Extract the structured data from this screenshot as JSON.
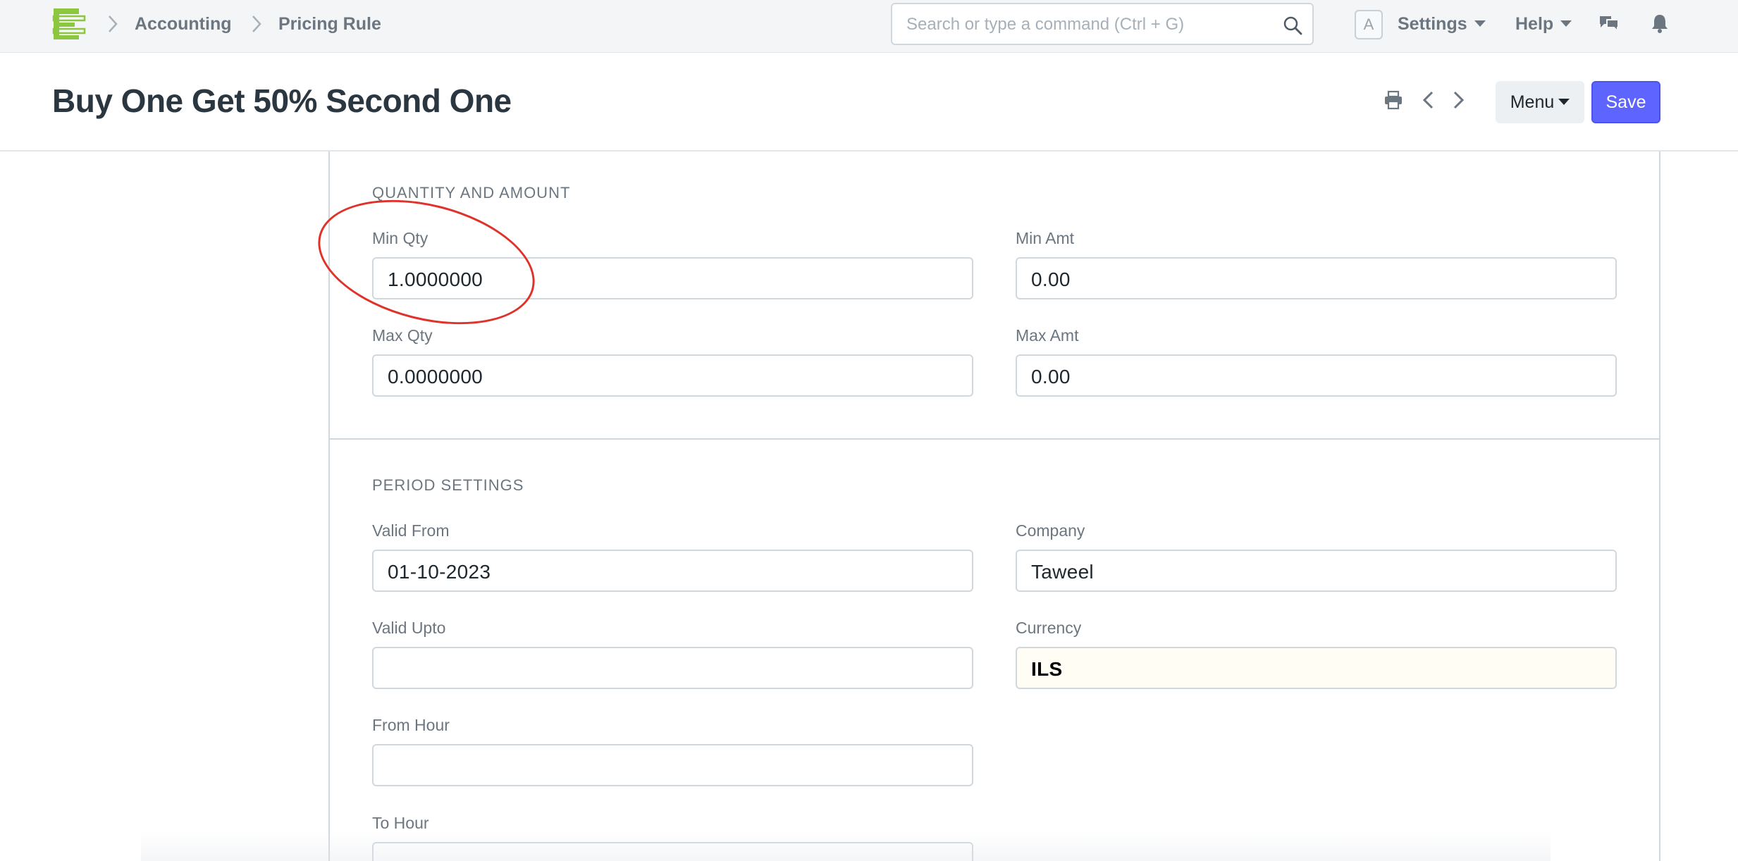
{
  "navbar": {
    "breadcrumbs": [
      {
        "label": "Accounting"
      },
      {
        "label": "Pricing Rule"
      }
    ],
    "search": {
      "placeholder": "Search or type a command (Ctrl + G)"
    },
    "avatar_letter": "A",
    "settings_label": "Settings",
    "help_label": "Help",
    "logo_color": "#8dc63f"
  },
  "page": {
    "title": "Buy One Get 50% Second One",
    "menu_label": "Menu",
    "save_label": "Save",
    "accent_color": "#5e64ff"
  },
  "sections": {
    "quantity": {
      "heading": "QUANTITY AND AMOUNT",
      "min_qty": {
        "label": "Min Qty",
        "value": "1.0000000"
      },
      "min_amt": {
        "label": "Min Amt",
        "value": "0.00"
      },
      "max_qty": {
        "label": "Max Qty",
        "value": "0.0000000"
      },
      "max_amt": {
        "label": "Max Amt",
        "value": "0.00"
      }
    },
    "period": {
      "heading": "PERIOD SETTINGS",
      "valid_from": {
        "label": "Valid From",
        "value": "01-10-2023"
      },
      "company": {
        "label": "Company",
        "value": "Taweel"
      },
      "valid_upto": {
        "label": "Valid Upto",
        "value": ""
      },
      "currency": {
        "label": "Currency",
        "value": "ILS"
      },
      "from_hour": {
        "label": "From Hour",
        "value": ""
      },
      "to_hour": {
        "label": "To Hour",
        "value": ""
      }
    }
  },
  "annotation_color": "#e0322a"
}
